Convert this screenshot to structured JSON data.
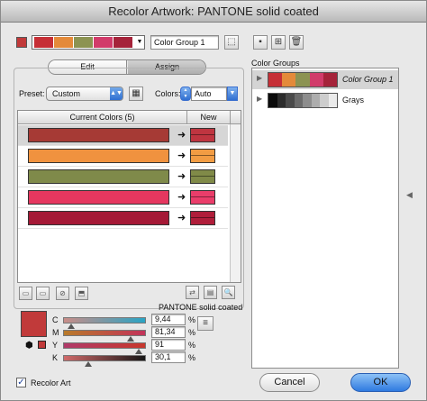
{
  "window": {
    "title": "Recolor Artwork: PANTONE solid coated"
  },
  "top": {
    "group_name": "Color Group 1",
    "strip_colors": [
      "#c62f36",
      "#e48a3a",
      "#8c9352",
      "#d13b6a",
      "#a5233a"
    ],
    "icons": [
      "save-icon",
      "new-group-icon",
      "trash-icon",
      "options-icon"
    ]
  },
  "tabs": {
    "edit": "Edit",
    "assign": "Assign",
    "active": "assign"
  },
  "preset": {
    "label": "Preset:",
    "value": "Custom"
  },
  "colors_select": {
    "label": "Colors:",
    "value": "Auto"
  },
  "table": {
    "header_current": "Current Colors (5)",
    "header_new": "New",
    "rows": [
      {
        "current": "#a63a35",
        "new": "#bf3540",
        "selected": true
      },
      {
        "current": "#f0923f",
        "new": "#f29c43",
        "selected": false
      },
      {
        "current": "#7f8a4a",
        "new": "#808a48",
        "selected": false
      },
      {
        "current": "#e5375f",
        "new": "#ea3d6a",
        "selected": false
      },
      {
        "current": "#a51936",
        "new": "#b01d3a",
        "selected": false
      }
    ]
  },
  "library_label": "PANTONE solid coated",
  "sliders": [
    {
      "label": "C",
      "value": "9,44",
      "level": 0.094
    },
    {
      "label": "M",
      "value": "81,34",
      "level": 0.813
    },
    {
      "label": "Y",
      "value": "91",
      "level": 0.91
    },
    {
      "label": "K",
      "value": "30,1",
      "level": 0.301
    }
  ],
  "pct_sign": "%",
  "current_swatch": "#c13a3a",
  "recolor_art": {
    "label": "Recolor Art",
    "checked": true
  },
  "color_groups": {
    "title": "Color Groups",
    "items": [
      {
        "name": "Color Group 1",
        "colors": [
          "#c62f36",
          "#e48a3a",
          "#8c9352",
          "#d13b6a",
          "#a5233a"
        ],
        "selected": true
      },
      {
        "name": "Grays",
        "colors": [
          "#0b0b0b",
          "#2c2c2c",
          "#4a4a4a",
          "#6b6b6b",
          "#8d8d8d",
          "#adadad",
          "#cdcdcd",
          "#ebebeb"
        ],
        "selected": false
      }
    ]
  },
  "buttons": {
    "cancel": "Cancel",
    "ok": "OK"
  }
}
